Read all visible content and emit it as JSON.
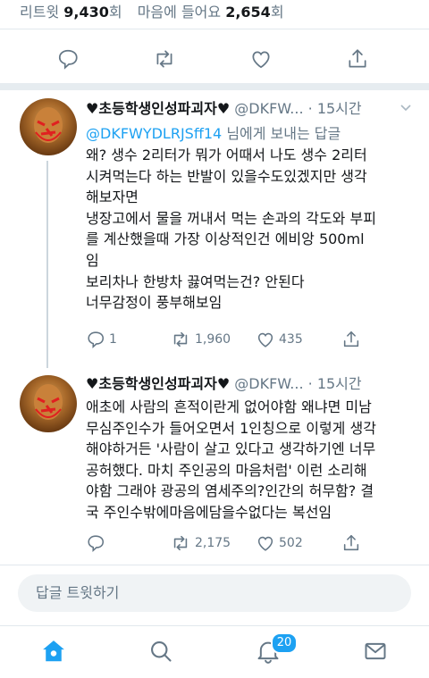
{
  "stats": {
    "retweets_label": "리트윗",
    "retweets_count": "9,430",
    "retweets_suffix": "회",
    "likes_label": "마음에 들어요",
    "likes_count": "2,654",
    "likes_suffix": "회"
  },
  "tweets": [
    {
      "display_name": "♥초등학생인성파괴자♥",
      "handle": "@DKFW...",
      "dot": "·",
      "time": "15시간",
      "reply_to_mention": "@DKFWYDLRJSff14",
      "reply_to_suffix": "님에게 보내는 답글",
      "text": "왜? 생수 2리터가 뭐가 어때서 나도 생수 2리터\n시켜먹는다 하는 반발이 있을수도있겠지만 생각\n해보자면\n냉장고에서 물을 꺼내서 먹는 손과의 각도와 부피\n를 계산했을때 가장 이상적인건 에비앙 500ml\n임\n보리차나 한방차 끓여먹는건? 안된다\n너무감정이 풍부해보임",
      "replies": "1",
      "retweets": "1,960",
      "likes": "435"
    },
    {
      "display_name": "♥초등학생인성파괴자♥",
      "handle": "@DKFW...",
      "dot": "·",
      "time": "15시간",
      "text": "애초에 사람의 흔적이란게 없어야함 왜냐면 미남\n무심주인수가 들어오면서 1인칭으로 이렇게 생각\n해야하거든 '사람이 살고 있다고 생각하기엔 너무\n공허했다. 마치 주인공의 마음처럼' 이런 소리해\n야함 그래야 광공의 염세주의?인간의 허무함? 결\n국 주인수밖에마음에담을수없다는 복선임",
      "replies": "",
      "retweets": "2,175",
      "likes": "502"
    }
  ],
  "composer": {
    "placeholder": "답글 트윗하기"
  },
  "tabbar": {
    "notifications_badge": "20"
  },
  "colors": {
    "accent": "#1da1f2",
    "muted": "#657786",
    "text": "#14171a"
  },
  "icons": [
    "reply-icon",
    "retweet-icon",
    "like-icon",
    "share-icon",
    "home-icon",
    "search-icon",
    "notifications-icon",
    "messages-icon",
    "chevron-down-icon"
  ]
}
